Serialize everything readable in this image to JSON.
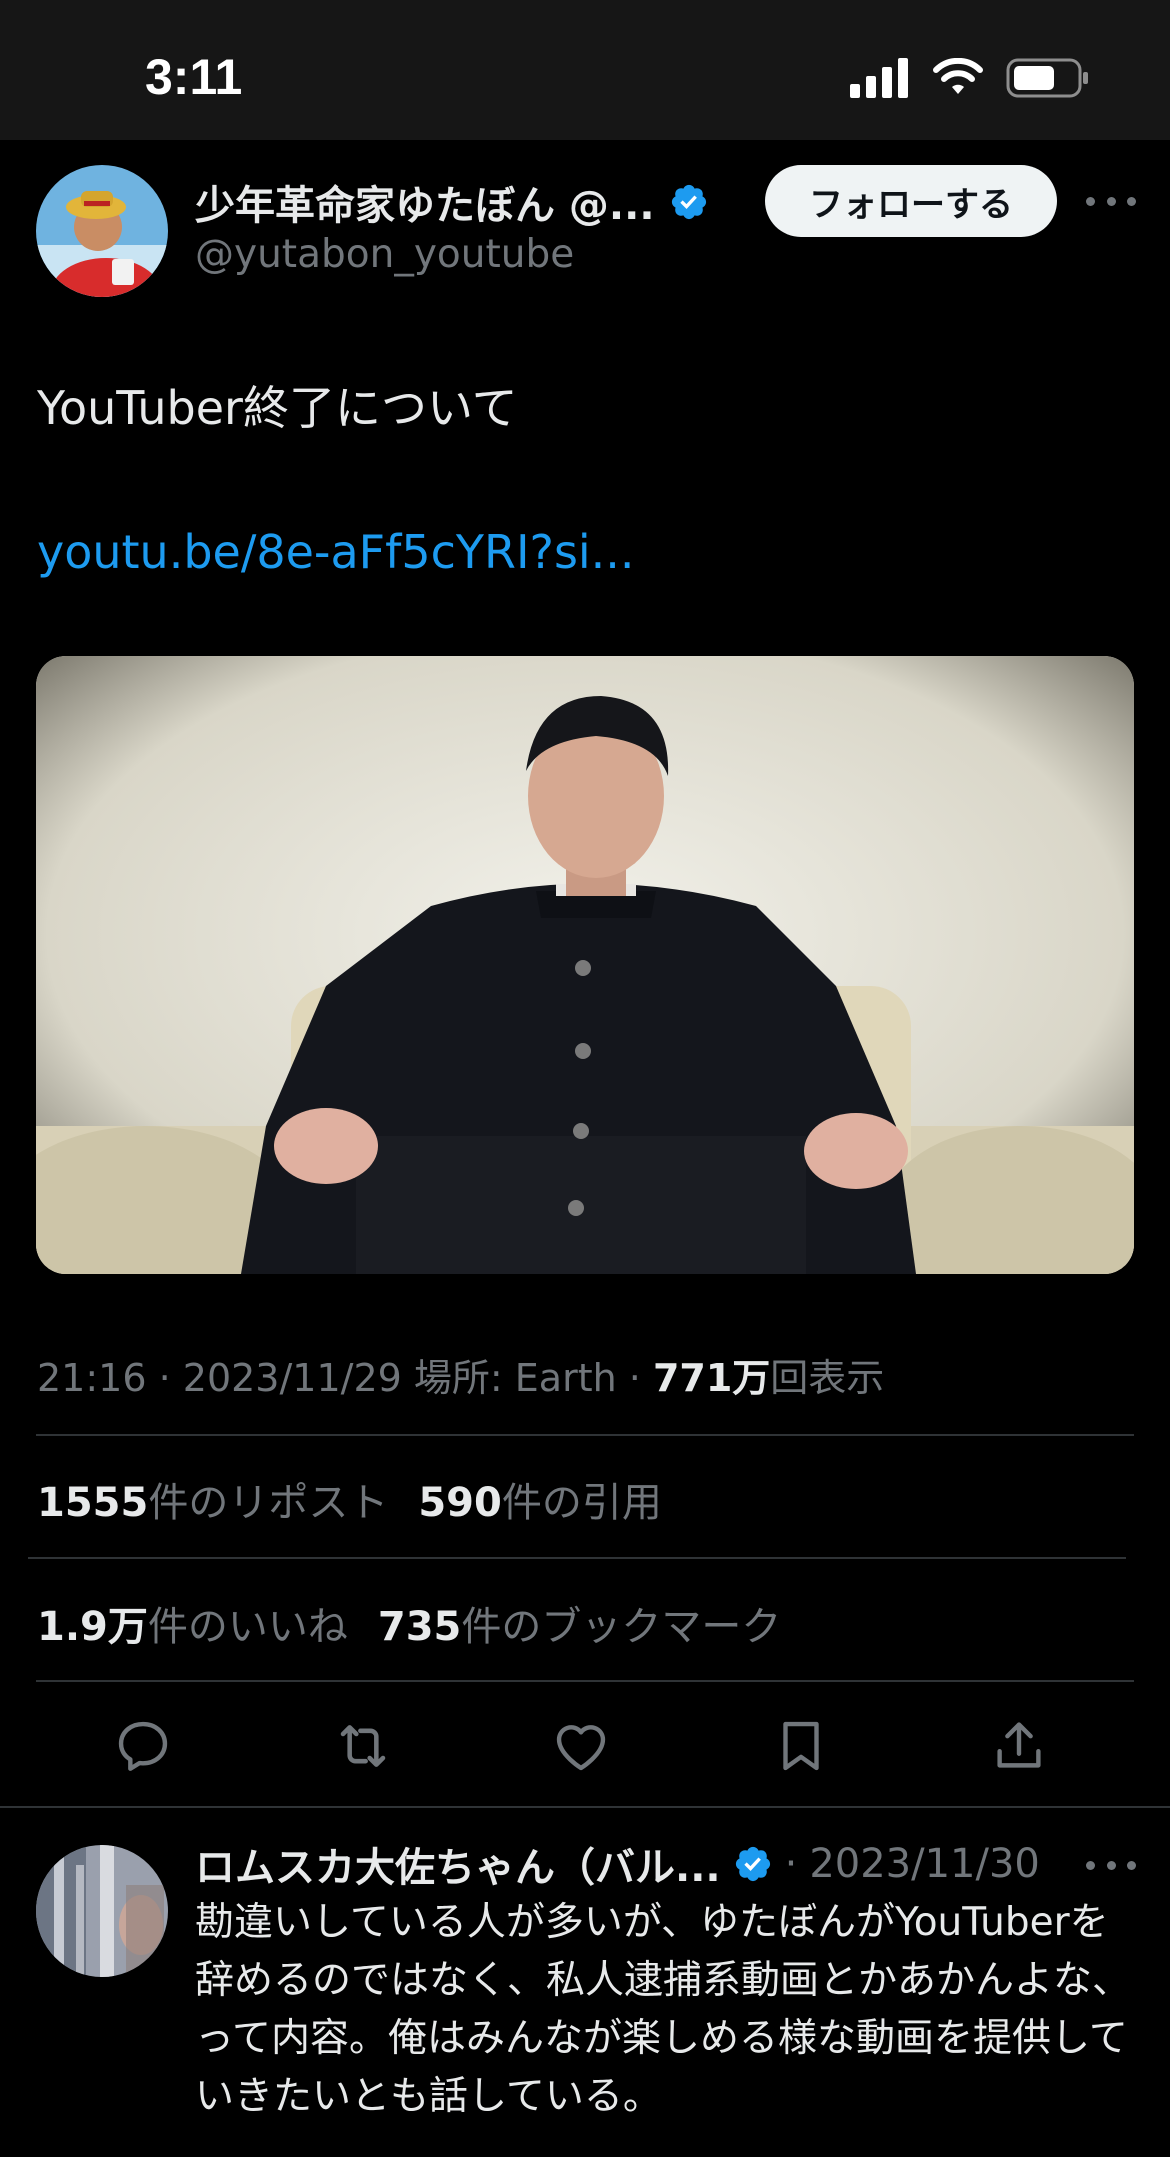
{
  "status_bar": {
    "time": "3:11"
  },
  "tweet": {
    "author_name": "少年革命家ゆたぼん @...",
    "author_handle": "@yutabon_youtube",
    "follow_label": "フォローする",
    "text": "YouTuber終了について",
    "link": "youtu.be/8e-aFf5cYRI?si...",
    "time": "21:16",
    "date": "2023/11/29",
    "location": "場所: Earth",
    "views_value": "771万",
    "views_label": "回表示",
    "reposts_value": "1555",
    "reposts_label": "件のリポスト",
    "quotes_value": "590",
    "quotes_label": "件の引用",
    "likes_value": "1.9万",
    "likes_label": "件のいいね",
    "bookmarks_value": "735",
    "bookmarks_label": "件のブックマーク"
  },
  "reply": {
    "author_name": "ロムスカ大佐ちゃん（バル...",
    "date": "2023/11/30",
    "text": "勘違いしている人が多いが、ゆたぼんがYouTuberを辞めるのではなく、私人逮捕系動画とかあかんよな、って内容。俺はみんなが楽しめる様な動画を提供していきたいとも話している。"
  },
  "colors": {
    "accent": "#1d9bf0",
    "verified": "#1d9bf0",
    "background": "#000000",
    "secondary_text": "#71767b"
  },
  "icons": [
    "signal-icon",
    "wifi-icon",
    "battery-icon",
    "verified-badge-icon",
    "more-icon",
    "reply-icon",
    "repost-icon",
    "like-icon",
    "bookmark-icon",
    "share-icon"
  ]
}
